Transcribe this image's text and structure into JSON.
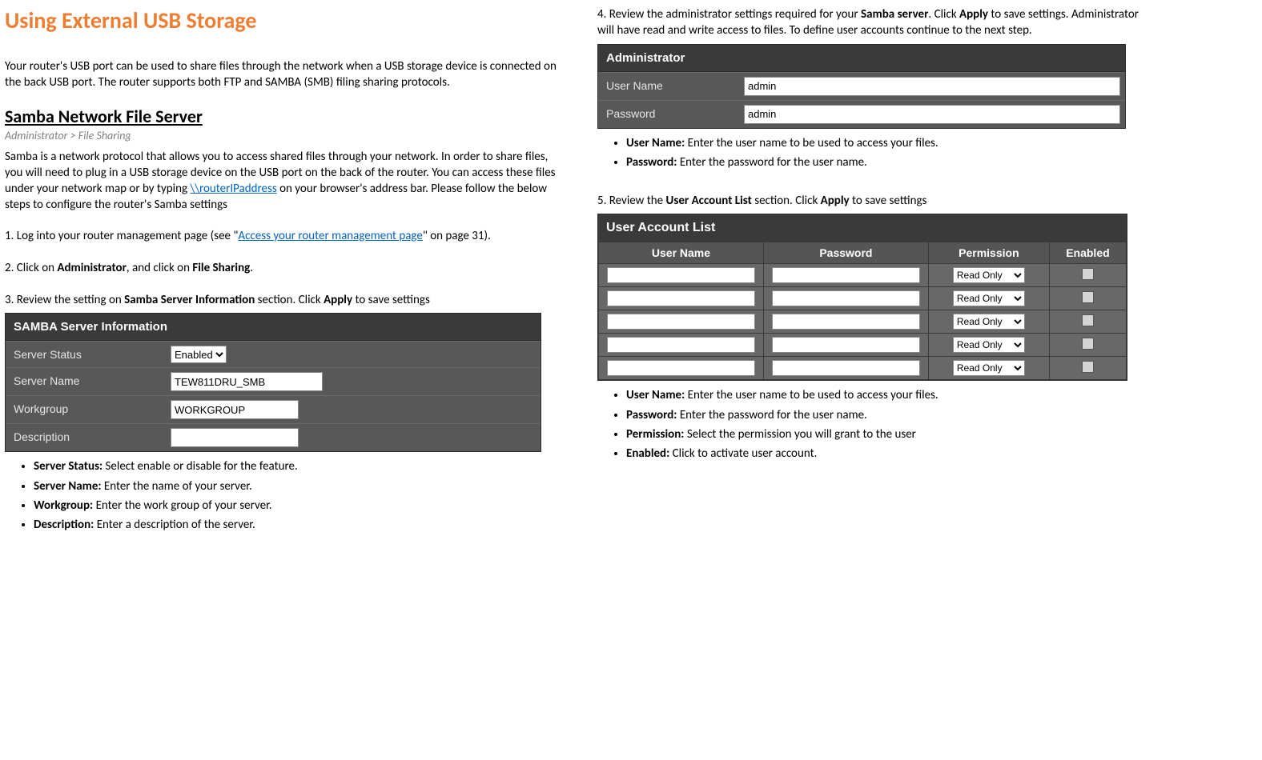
{
  "title": "Using External USB Storage",
  "intro": "Your router's USB port can be used to share files through the network when a USB storage device is connected on the back USB port. The router supports both FTP and SAMBA (SMB) filing sharing protocols.",
  "samba": {
    "heading": "Samba Network File Server",
    "breadcrumb": "Administrator > File Sharing",
    "para_part1": "Samba is a network protocol that allows you to access shared files through your network. In order to share files, you will need to plug in a USB storage device on the USB port on the back of the router. You can access these files under your network map or by typing ",
    "link": "\\\\routerIPaddress",
    "para_part2": " on your browser's address bar. Please follow the below steps to configure the router's Samba settings"
  },
  "step1": {
    "pre": "1. Log into your router management page (see \"",
    "link": "Access your router management page",
    "post": "\" on page 31)."
  },
  "step2": {
    "pre": "2. Click on ",
    "b1": "Administrator",
    "mid": ", and click on ",
    "b2": "File Sharing",
    "post": "."
  },
  "step3": {
    "pre": "3. Review the setting on ",
    "b1": "Samba Server Information",
    "mid": " section. Click ",
    "b2": "Apply",
    "post": " to save settings"
  },
  "sambaPanel": {
    "title": "SAMBA Server Information",
    "rows": {
      "status_label": "Server Status",
      "status_value": "Enabled",
      "name_label": "Server Name",
      "name_value": "TEW811DRU_SMB",
      "workgroup_label": "Workgroup",
      "workgroup_value": "WORKGROUP",
      "desc_label": "Description",
      "desc_value": ""
    }
  },
  "sambaBullets": {
    "b1_label": "Server Status:",
    "b1_text": " Select enable or disable for the feature.",
    "b2_label": "Server Name:",
    "b2_text": " Enter the name of your server.",
    "b3_label": "Workgroup:",
    "b3_text": " Enter the work group of your server.",
    "b4_label": "Description:",
    "b4_text": " Enter a description of the server."
  },
  "step4": {
    "pre": "4. Review the administrator settings required for your ",
    "b1": "Samba server",
    "mid1": ". Click ",
    "b2": "Apply",
    "post": " to save settings. Administrator will have read and write access to files. To define user accounts continue to the next step."
  },
  "adminPanel": {
    "title": "Administrator",
    "user_label": "User Name",
    "user_value": "admin",
    "pass_label": "Password",
    "pass_value": "admin"
  },
  "adminBullets": {
    "b1_label": "User Name:",
    "b1_text": " Enter the user name to be used to access your files.",
    "b2_label": "Password:",
    "b2_text": " Enter the password for the user name."
  },
  "step5": {
    "pre": "5. Review the ",
    "b1": "User Account List",
    "mid": " section. Click ",
    "b2": "Apply",
    "post": " to save settings"
  },
  "ual": {
    "title": "User Account List",
    "head_user": "User Name",
    "head_pass": "Password",
    "head_perm": "Permission",
    "head_en": "Enabled",
    "perm_value": "Read Only",
    "rowcount": 5
  },
  "ualBullets": {
    "b1_label": "User Name:",
    "b1_text": " Enter the user name to be used to access your files.",
    "b2_label": "Password:",
    "b2_text": " Enter the password for the user name.",
    "b3_label": "Permission:",
    "b3_text": " Select the permission you will grant to the user",
    "b4_label": "Enabled:",
    "b4_text": " Click to activate user account."
  }
}
